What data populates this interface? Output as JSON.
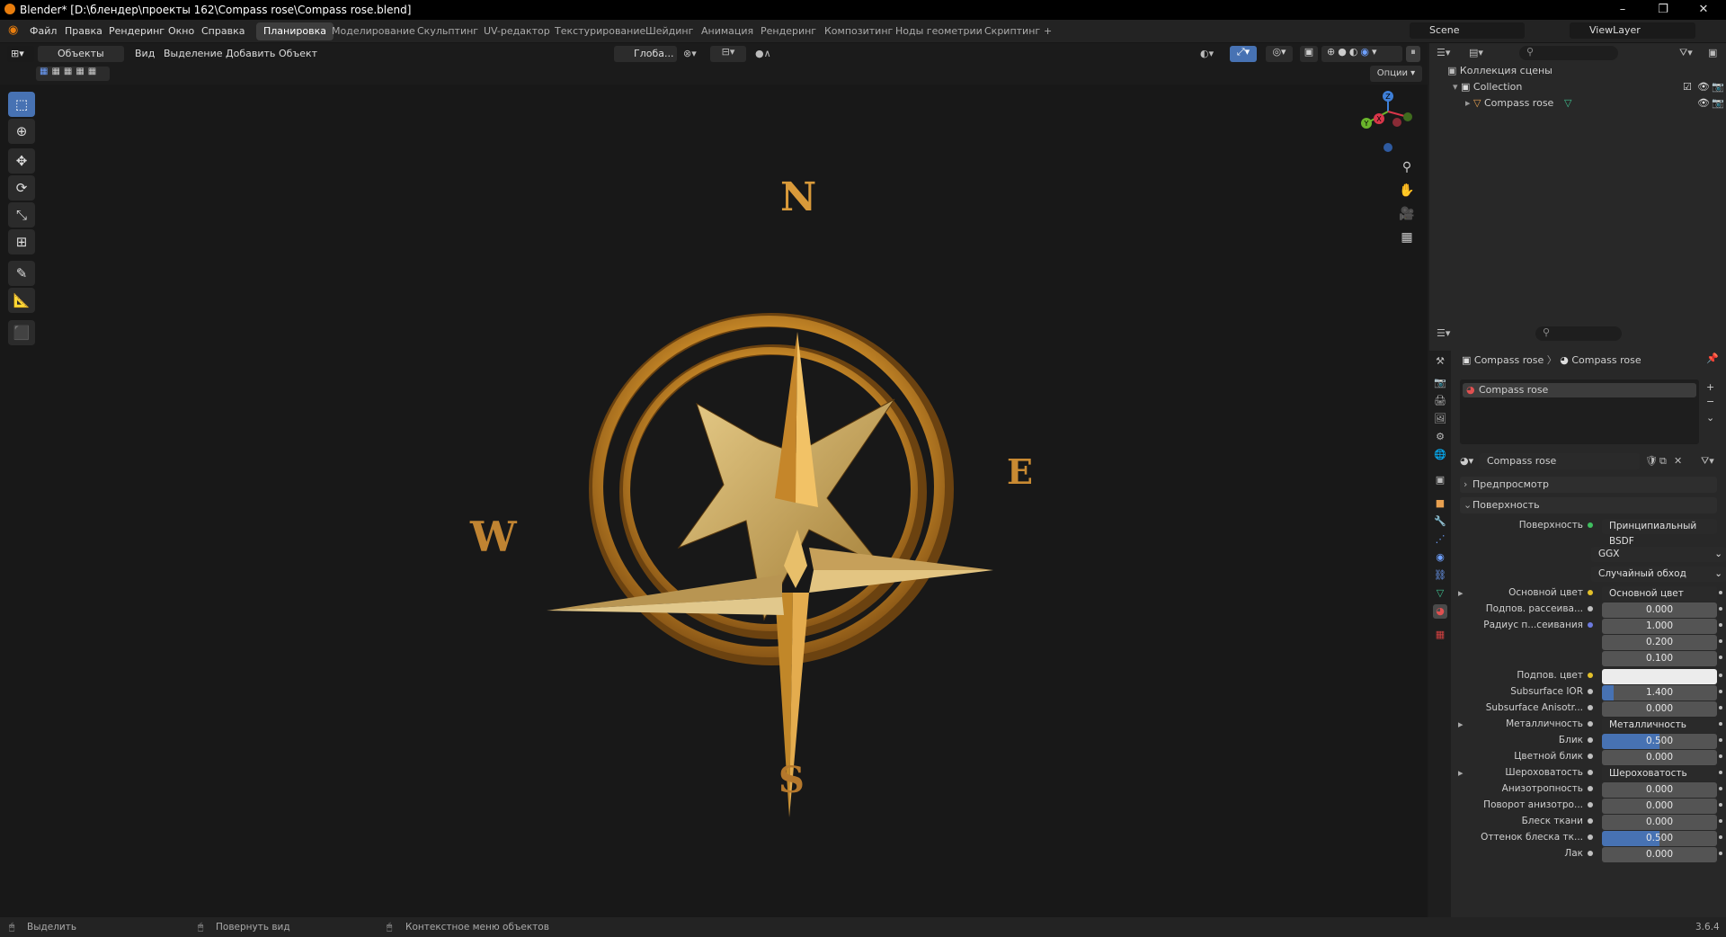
{
  "window": {
    "title": "Blender* [D:\\блендер\\проекты 162\\Compass rose\\Compass rose.blend]"
  },
  "menu": [
    "Файл",
    "Правка",
    "Рендеринг",
    "Окно",
    "Справка"
  ],
  "workspaces": [
    "Планировка",
    "Моделирование",
    "Скульптинг",
    "UV-редактор",
    "Текстурирование",
    "Шейдинг",
    "Анимация",
    "Рендеринг",
    "Композитинг",
    "Ноды геометрии",
    "Скриптинг"
  ],
  "workspace_add": "+",
  "scene": {
    "name": "Scene",
    "view_layer": "ViewLayer"
  },
  "viewport": {
    "mode": "Объекты",
    "menu": [
      "Вид",
      "Выделение",
      "Добавить",
      "Объект"
    ],
    "orientation": "Глоба...",
    "options": "Опции",
    "letters": {
      "n": "N",
      "e": "E",
      "s": "S",
      "w": "W"
    },
    "gizmo": {
      "x": "X",
      "y": "Y",
      "z": "Z"
    }
  },
  "outliner": {
    "scene_collection": "Коллекция сцены",
    "collection": "Collection",
    "object": "Compass rose"
  },
  "properties": {
    "breadcrumb": [
      "Compass rose",
      "Compass rose"
    ],
    "material_slot": "Compass rose",
    "material_name": "Compass rose",
    "panels": {
      "preview": "Предпросмотр",
      "surface": "Поверхность"
    },
    "surface_label": "Поверхность",
    "surface_value": "Принципиальный BSDF",
    "distribution": "GGX",
    "subsurface_method": "Случайный обход",
    "rows": [
      {
        "label": "Основной цвет",
        "value": "Основной цвет",
        "kind": "node",
        "dot": "y",
        "arrow": true
      },
      {
        "label": "Подпов. рассеива...",
        "value": "0.000",
        "kind": "num",
        "dot": "n"
      },
      {
        "label": "Радиус п...сеивания",
        "value": "1.000",
        "kind": "num",
        "dot": "b"
      },
      {
        "label": "",
        "value": "0.200",
        "kind": "num"
      },
      {
        "label": "",
        "value": "0.100",
        "kind": "num"
      },
      {
        "label": "Подпов. цвет",
        "value": "",
        "kind": "white",
        "dot": "y"
      },
      {
        "label": "Subsurface IOR",
        "value": "1.400",
        "kind": "blue",
        "fill": 0.1,
        "dot": "n"
      },
      {
        "label": "Subsurface Anisotr...",
        "value": "0.000",
        "kind": "num",
        "dot": "n"
      },
      {
        "label": "Металличность",
        "value": "Металличность",
        "kind": "node",
        "dot": "n",
        "arrow": true
      },
      {
        "label": "Блик",
        "value": "0.500",
        "kind": "blue",
        "fill": 0.5,
        "dot": "n"
      },
      {
        "label": "Цветной блик",
        "value": "0.000",
        "kind": "num",
        "dot": "n"
      },
      {
        "label": "Шероховатость",
        "value": "Шероховатость",
        "kind": "node",
        "dot": "n",
        "arrow": true
      },
      {
        "label": "Анизотропность",
        "value": "0.000",
        "kind": "num",
        "dot": "n"
      },
      {
        "label": "Поворот анизотро...",
        "value": "0.000",
        "kind": "num",
        "dot": "n"
      },
      {
        "label": "Блеск ткани",
        "value": "0.000",
        "kind": "num",
        "dot": "n"
      },
      {
        "label": "Оттенок блеска тк...",
        "value": "0.500",
        "kind": "blue",
        "fill": 0.5,
        "dot": "n"
      },
      {
        "label": "Лак",
        "value": "0.000",
        "kind": "num",
        "dot": "n"
      }
    ]
  },
  "status": {
    "select": "Выделить",
    "rotate": "Повернуть вид",
    "context": "Контекстное меню объектов",
    "version": "3.6.4"
  }
}
